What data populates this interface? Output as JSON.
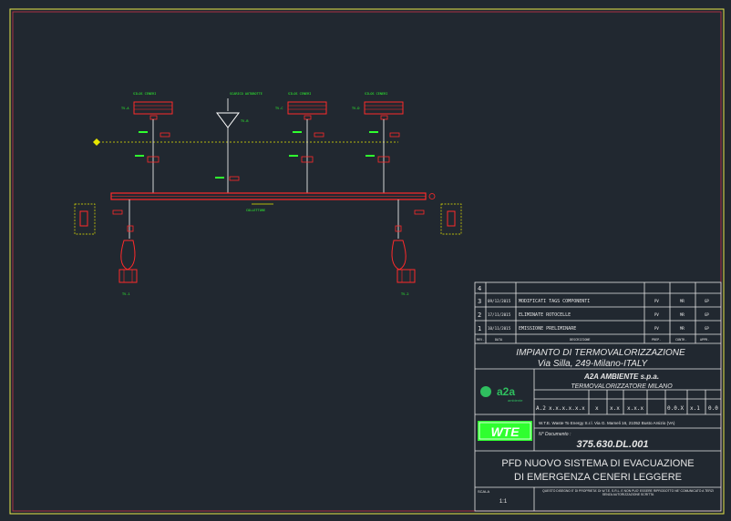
{
  "colors": {
    "background": "#212830",
    "frame": "#e8e84a",
    "frame_inner": "#c8324a",
    "title_block": "#e6e6e6",
    "pipe": "#ff2a2a",
    "label": "#2fff2f",
    "signal": "#e6e600",
    "line": "#ffffff"
  },
  "drawing": {
    "tanks": [
      {
        "tag": "SILOS CENERI",
        "label": "TV-A"
      },
      {
        "tag": "SCARICO AUTOBOTTE",
        "label": "TV-B"
      },
      {
        "tag": "SILOS CENERI",
        "label": "TV-C"
      },
      {
        "tag": "SILOS CENERI",
        "label": "TV-D"
      }
    ],
    "header_label": "COLLETTORE",
    "bottom_left_label": "TV-1",
    "bottom_right_label": "TV-2"
  },
  "revisions": {
    "rows": [
      {
        "rev": "4",
        "date": "",
        "desc": "",
        "by": "",
        "chk": "",
        "app": ""
      },
      {
        "rev": "3",
        "date": "09/12/2015",
        "desc": "MODIFICATI TAGS COMPONENTI",
        "by": "PV",
        "chk": "MR",
        "app": "GP"
      },
      {
        "rev": "2",
        "date": "17/11/2015",
        "desc": "ELIMINATE ROTOCELLE",
        "by": "PV",
        "chk": "MR",
        "app": "GP"
      },
      {
        "rev": "1",
        "date": "10/11/2015",
        "desc": "EMISSIONE PRELIMINARE",
        "by": "PV",
        "chk": "MR",
        "app": "GP"
      }
    ],
    "header": {
      "rev": "REV.",
      "date": "DATA",
      "desc": "DESCRIZIONE",
      "by": "PREP.",
      "chk": "CONTR.",
      "app": "APPR."
    }
  },
  "title_block": {
    "project_line1": "IMPIANTO DI TERMOVALORIZZAZIONE",
    "project_line2": "Via Silla, 249-Milano-ITALY",
    "client_line1": "A2A AMBIENTE s.p.a.",
    "client_line2": "TERMOVALORIZZATORE MILANO",
    "logo_text": "a2a",
    "logo_sub": "ambiente",
    "code_fields": [
      "A.2",
      "x.x.x.x.x.x",
      "x",
      "x.x",
      "x.x.x",
      "0.0.X",
      "x.1",
      "0.0"
    ],
    "wte_logo": "WTE",
    "company": "W.T.E. Waste To Energy S.r.l. Via G. Mameli 16, 21052 Busto Arsizio (VA)",
    "doc_label": "N° Documento :",
    "doc_number": "375.630.DL.001",
    "title_line1": "PFD NUOVO SISTEMA DI EVACUAZIONE",
    "title_line2": "DI EMERGENZA CENERI LEGGERE",
    "scale_label": "SCALA",
    "scale_value": "1:1",
    "disclaimer": "QUESTO DISEGNO E' DI PROPRIETA' DI W.T.E. S.R.L. E NON PUO' ESSERE RIPRODOTTO NE' COMUNICATO A TERZI SENZA AUTORIZZAZIONE SCRITTA"
  }
}
